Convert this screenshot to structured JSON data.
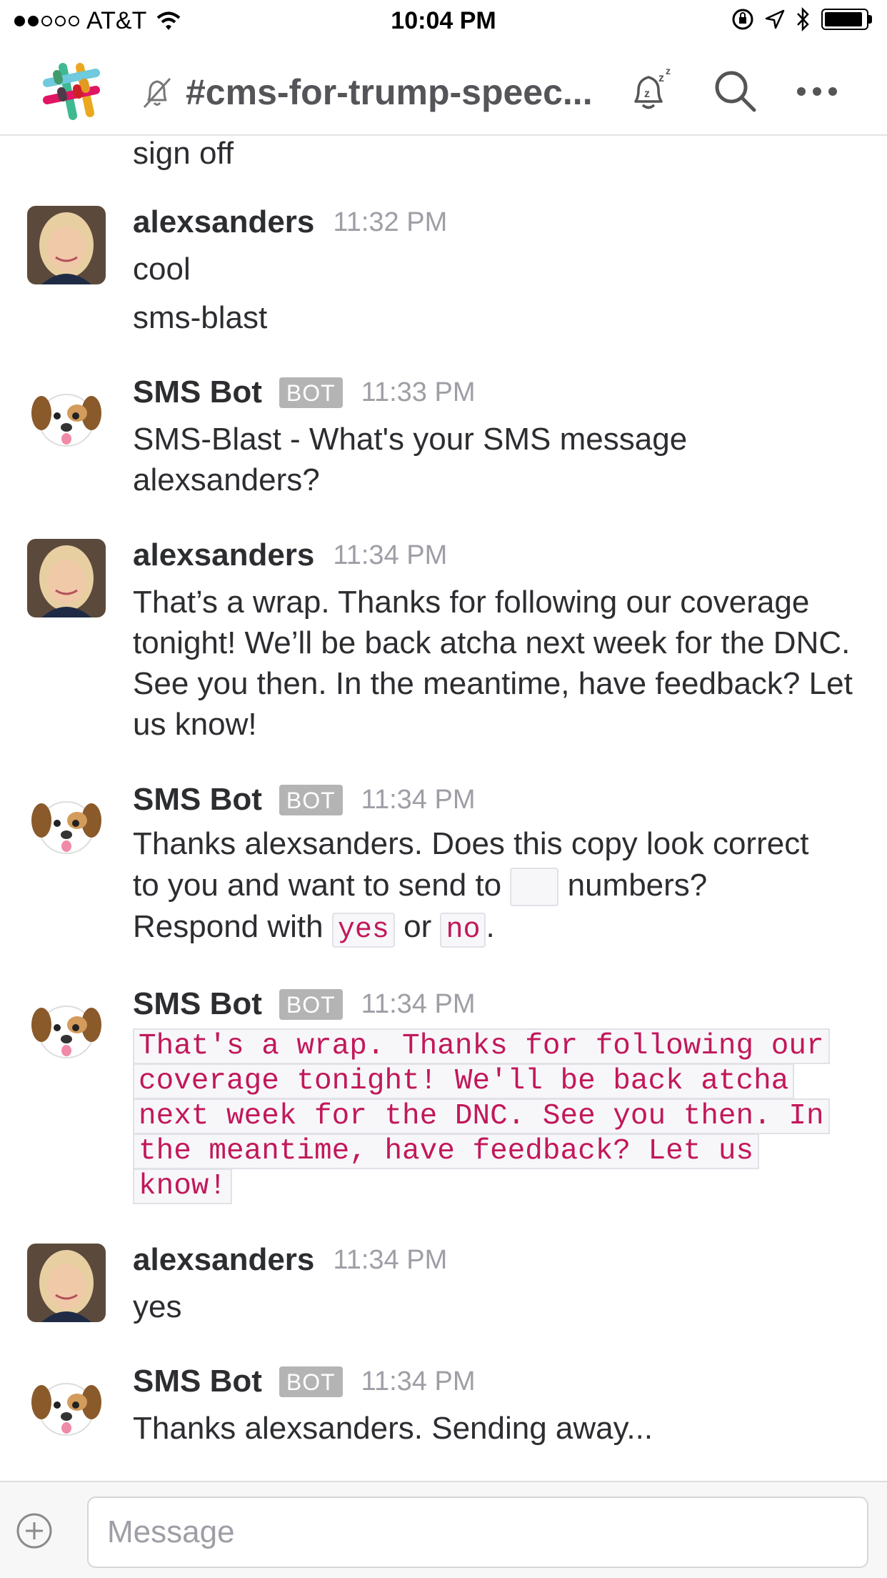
{
  "status_bar": {
    "carrier": "AT&T",
    "time": "10:04 PM",
    "signal_bars": 2,
    "signal_total": 5
  },
  "header": {
    "channel": "#cms-for-trump-speec...",
    "icons": [
      "slack-logo-icon",
      "muted-bell-icon",
      "snooze-icon",
      "search-icon",
      "more-icon"
    ]
  },
  "messages": {
    "m0": {
      "lines": [
        "sign off"
      ]
    },
    "m1": {
      "author": "alexsanders",
      "time": "11:32 PM",
      "lines": [
        "cool",
        "sms-blast"
      ]
    },
    "m2": {
      "author": "SMS Bot",
      "badge": "BOT",
      "time": "11:33 PM",
      "text": "SMS-Blast - What's your SMS message alexsanders?"
    },
    "m3": {
      "author": "alexsanders",
      "time": "11:34 PM",
      "text": "That’s a wrap. Thanks for following our coverage tonight! We’ll be back atcha next week for the DNC. See you then. In the meantime, have feedback? Let us know!"
    },
    "m4": {
      "author": "SMS Bot",
      "badge": "BOT",
      "time": "11:34 PM",
      "line1": "Thanks alexsanders. Does this copy look correct",
      "line2_a": "to you and want to send to",
      "line2_b": "numbers?",
      "line3_a": "Respond with",
      "code_yes": "yes",
      "line3_b": "or",
      "code_no": "no",
      "line3_c": "."
    },
    "m5": {
      "author": "SMS Bot",
      "badge": "BOT",
      "time": "11:34 PM",
      "code_lines": [
        "That's a wrap. Thanks for following our",
        "coverage tonight! We'll be back atcha",
        "next week for the DNC. See you then. In",
        "the meantime, have feedback? Let us",
        "know!"
      ]
    },
    "m6": {
      "author": "alexsanders",
      "time": "11:34 PM",
      "lines": [
        "yes"
      ]
    },
    "m7": {
      "author": "SMS Bot",
      "badge": "BOT",
      "time": "11:34 PM",
      "text": "Thanks alexsanders. Sending away..."
    }
  },
  "composer": {
    "placeholder": "Message"
  },
  "colors": {
    "code_text": "#c2185b",
    "timestamp": "#9e9ea6",
    "badge_bg": "#b4b4b4",
    "channel_text": "#555459"
  }
}
